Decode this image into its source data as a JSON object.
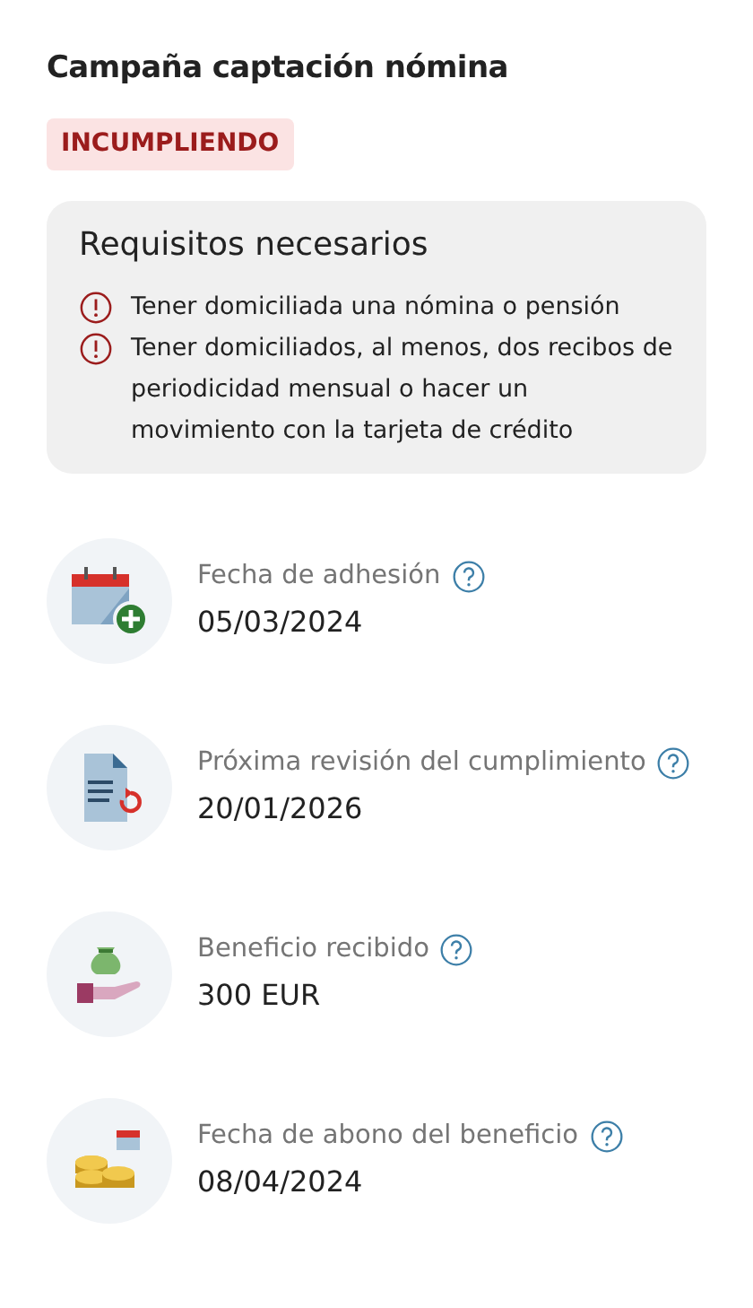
{
  "title": "Campaña captación nómina",
  "status": {
    "label": "INCUMPLIENDO",
    "kind": "failing"
  },
  "requirements": {
    "title": "Requisitos necesarios",
    "items": [
      {
        "text": "Tener domiciliada una nómina o pensión",
        "met": false
      },
      {
        "text": "Tener domiciliados, al menos, dos recibos de periodicidad mensual o hacer un movimiento con la tarjeta de crédito",
        "met": false
      }
    ]
  },
  "details": [
    {
      "kind": "calendar-add",
      "label": "Fecha de adhesión",
      "value": "05/03/2024"
    },
    {
      "kind": "document-refresh",
      "label": "Próxima revisión del cumplimiento",
      "value": "20/01/2026"
    },
    {
      "kind": "money-hand",
      "label": "Beneficio recibido",
      "value": "300 EUR"
    },
    {
      "kind": "coins-calendar",
      "label": "Fecha de abono del beneficio",
      "value": "08/04/2024"
    }
  ]
}
